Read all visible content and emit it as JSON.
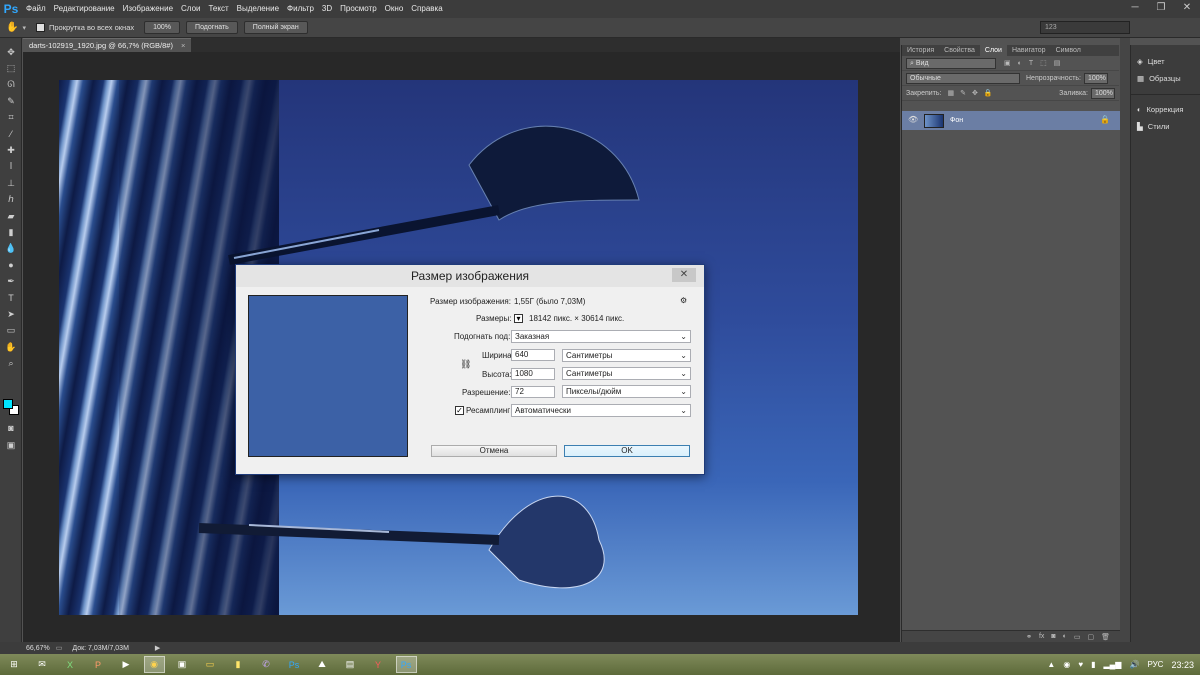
{
  "app": {
    "logo": "Ps"
  },
  "menu": [
    "Файл",
    "Редактирование",
    "Изображение",
    "Слои",
    "Текст",
    "Выделение",
    "Фильтр",
    "3D",
    "Просмотр",
    "Окно",
    "Справка"
  ],
  "options_bar": {
    "scroll_all_label": "Прокрутка во всех окнах",
    "btn_100": "100%",
    "btn_fit": "Подогнать",
    "btn_fullscreen": "Полный экран",
    "field_value": "123"
  },
  "document": {
    "tab_title": "darts-102919_1920.jpg @ 66,7% (RGB/8#)",
    "tab_close": "×"
  },
  "status": {
    "zoom": "66,67%",
    "doc_info": "Док: 7,03M/7,03M"
  },
  "layers_panel": {
    "tabs": [
      "История",
      "Свойства",
      "Слои",
      "Навигатор",
      "Символ"
    ],
    "active_tab": "Слои",
    "filter_label": "Вид",
    "blend_mode": "Обычные",
    "opacity_label": "Непрозрачность:",
    "opacity_value": "100%",
    "lock_label": "Закрепить:",
    "fill_label": "Заливка:",
    "fill_value": "100%",
    "layer_name": "Фон"
  },
  "dock": {
    "items": [
      "Цвет",
      "Образцы",
      "Коррекция",
      "Стили"
    ]
  },
  "dialog": {
    "title": "Размер изображения",
    "close": "✕",
    "image_size_label": "Размер изображения:",
    "image_size_value": "1,55Г (было 7,03M)",
    "dimensions_label": "Размеры:",
    "dimensions_value": "18142 пикс.  ×  30614 пикс.",
    "fit_label": "Подогнать под:",
    "fit_value": "Заказная",
    "width_label": "Ширина:",
    "width_value": "640",
    "width_unit": "Сантиметры",
    "height_label": "Высота:",
    "height_value": "1080",
    "height_unit": "Сантиметры",
    "resolution_label": "Разрешение:",
    "resolution_value": "72",
    "resolution_unit": "Пикселы/дюйм",
    "resample_label": "Ресамплинг:",
    "resample_value": "Автоматически",
    "cancel": "Отмена",
    "ok": "OK"
  },
  "taskbar": {
    "lang": "РУС",
    "time": "23:23"
  }
}
